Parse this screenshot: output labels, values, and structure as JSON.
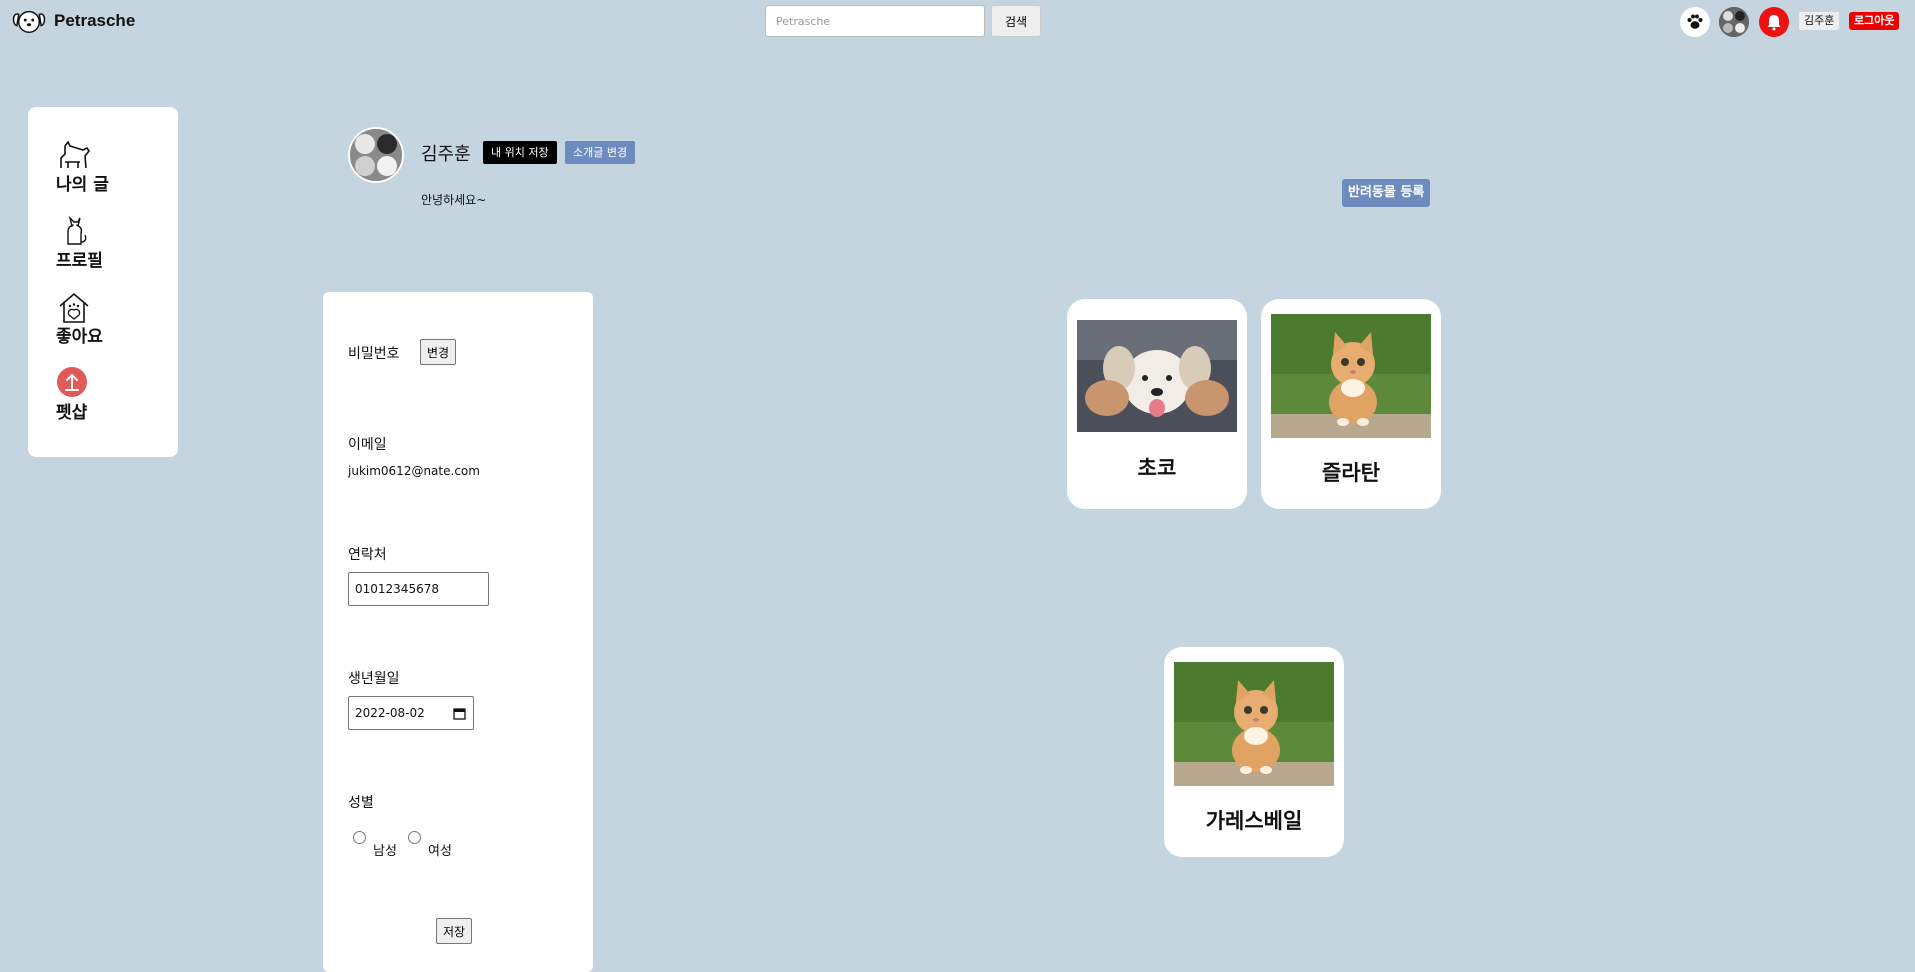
{
  "app": {
    "name": "Petrasche"
  },
  "header": {
    "search_placeholder": "Petrasche",
    "search_button": "검색",
    "user_name": "김주훈",
    "logout": "로그아웃"
  },
  "sidebar": {
    "items": [
      {
        "label": "나의 글",
        "icon": "dog-icon"
      },
      {
        "label": "프로필",
        "icon": "cat-icon"
      },
      {
        "label": "좋아요",
        "icon": "pet-house-icon"
      },
      {
        "label": "펫샵",
        "icon": "upload-icon"
      }
    ]
  },
  "profile": {
    "name": "김주훈",
    "save_location_button": "내 위치 저장",
    "change_intro_button": "소개글 변경",
    "intro": "안녕하세요~",
    "register_pet_button": "반려동물 등록"
  },
  "form": {
    "password_label": "비밀번호",
    "password_change_button": "변경",
    "email_label": "이메일",
    "email_value": "jukim0612@nate.com",
    "phone_label": "연락처",
    "phone_value": "01012345678",
    "birth_label": "생년월일",
    "birth_value": "2022-08-02",
    "gender_label": "성별",
    "gender_male": "남성",
    "gender_female": "여성",
    "save_button": "저장"
  },
  "pets": [
    {
      "name": "초코",
      "photo": "puppy-photo"
    },
    {
      "name": "즐라탄",
      "photo": "kitten-photo"
    },
    {
      "name": "가레스베일",
      "photo": "kitten-photo"
    }
  ],
  "colors": {
    "background": "#c4d5e0",
    "accent": "#6d8bbf",
    "alert": "#ee1111"
  }
}
